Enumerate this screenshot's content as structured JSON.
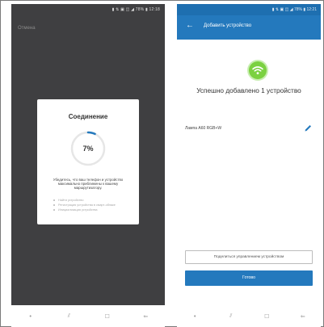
{
  "left_screen": {
    "status_bar": "▮ ⇅ ▣ ◫ ◢ 78% ▮ 12:18",
    "cancel_label": "Отмена",
    "dialog": {
      "title": "Соединение",
      "progress_text": "7%",
      "progress_fraction": 0.07,
      "message": "Убедитесь, что ваш телефон и устройство максимально приближены к вашему маршрутизатору.",
      "steps": [
        "Найти устройство",
        "Регистрация устройства в смарт-облаке",
        "Инициализация устройства"
      ]
    },
    "nav": {
      "menu": "•",
      "recents": "⫽",
      "home": "☐",
      "back": "⇐"
    }
  },
  "right_screen": {
    "status_bar": "▮ ⇅ ▣ ◫ ◢ 78% ▮ 12:21",
    "header": {
      "back": "←",
      "title": "Добавить устройство"
    },
    "success_text": "Успешно добавлено 1 устройство",
    "device_name": "Лампа A60 RGB+W",
    "share_button": "Поделиться управлением устройством",
    "done_button": "Готово",
    "nav": {
      "menu": "•",
      "recents": "⫽",
      "home": "☐",
      "back": "⇐"
    },
    "colors": {
      "primary": "#2479bd",
      "success": "#7bd141"
    }
  }
}
